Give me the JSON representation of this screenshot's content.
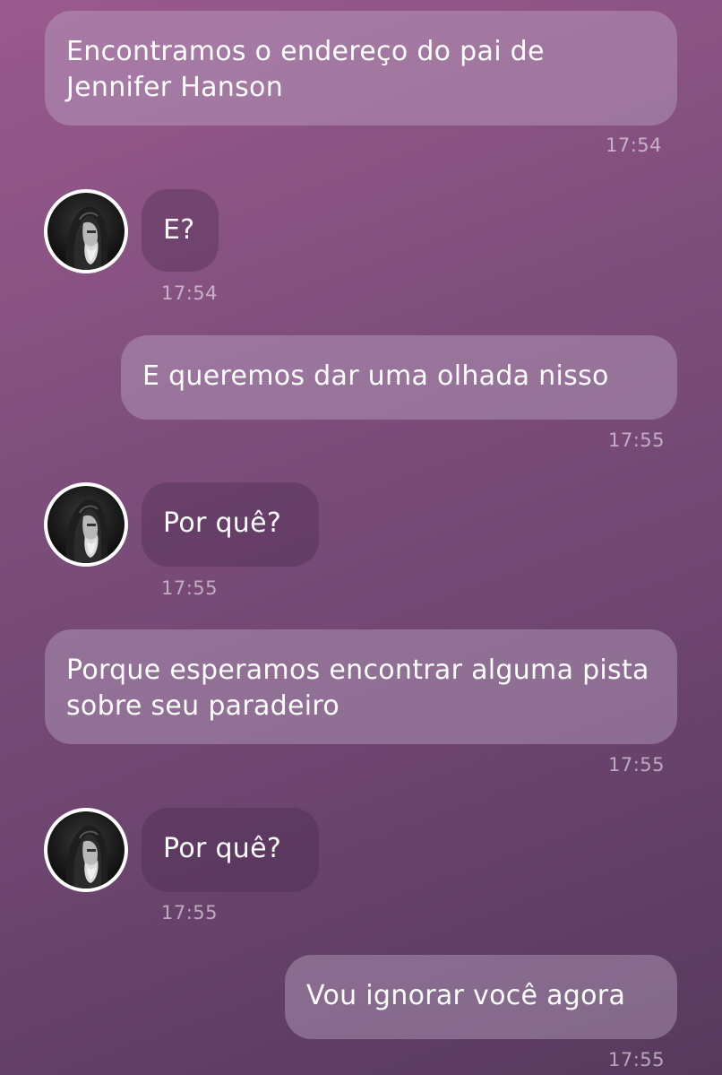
{
  "messages": [
    {
      "direction": "outgoing",
      "text": "Encontramos o endereço do pai de Jennifer Hanson",
      "time": "17:54"
    },
    {
      "direction": "incoming",
      "text": "E?",
      "time": "17:54",
      "avatar_icon": "hooded-bearded-man-avatar"
    },
    {
      "direction": "outgoing",
      "text": "E queremos dar uma olhada nisso",
      "time": "17:55"
    },
    {
      "direction": "incoming",
      "text": "Por quê?",
      "time": "17:55",
      "avatar_icon": "hooded-bearded-man-avatar"
    },
    {
      "direction": "outgoing",
      "text": "Porque esperamos encontrar alguma pista sobre seu paradeiro",
      "time": "17:55"
    },
    {
      "direction": "incoming",
      "text": "Por quê?",
      "time": "17:55",
      "avatar_icon": "hooded-bearded-man-avatar"
    },
    {
      "direction": "outgoing",
      "text": "Vou ignorar você agora",
      "time": "17:55"
    }
  ],
  "colors": {
    "background_top": "#9a5a8e",
    "background_bottom": "#563a5c",
    "outgoing_bubble": "#b59ab8",
    "incoming_bubble": "#5e3a62",
    "text": "#ffffff"
  }
}
